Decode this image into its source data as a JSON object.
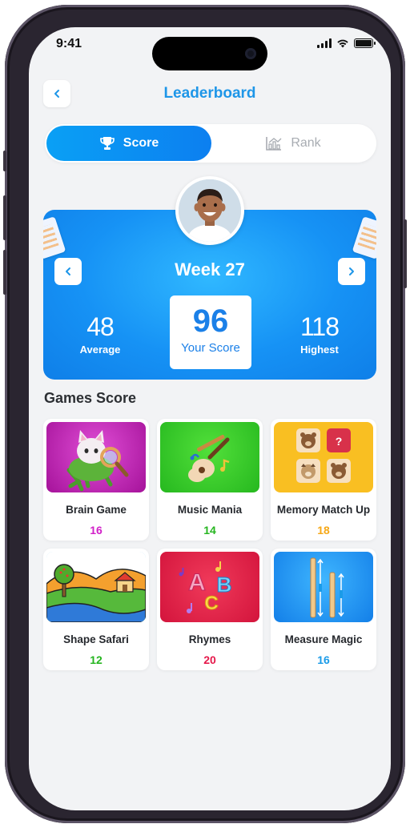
{
  "status_bar": {
    "time": "9:41"
  },
  "header": {
    "title": "Leaderboard"
  },
  "segments": {
    "active_label": "Score",
    "inactive_label": "Rank"
  },
  "score_card": {
    "week_label": "Week 27",
    "average": {
      "value": "48",
      "label": "Average"
    },
    "your_score": {
      "value": "96",
      "label": "Your Score"
    },
    "highest": {
      "value": "118",
      "label": "Highest"
    }
  },
  "games_section": {
    "title": "Games Score",
    "items": [
      {
        "name": "Brain Game",
        "score": "16",
        "score_color": "#d11fc8",
        "thumb": "cat-magnifier-icon"
      },
      {
        "name": "Music Mania",
        "score": "14",
        "score_color": "#25b51f",
        "thumb": "guitar-icon"
      },
      {
        "name": "Memory Match Up",
        "score": "18",
        "score_color": "#f6a817",
        "thumb": "memory-cards-icon"
      },
      {
        "name": "Shape Safari",
        "score": "12",
        "score_color": "#25b51f",
        "thumb": "landscape-icon"
      },
      {
        "name": "Rhymes",
        "score": "20",
        "score_color": "#e5184a",
        "thumb": "abc-letters-icon"
      },
      {
        "name": "Measure Magic",
        "score": "16",
        "score_color": "#1a9be8",
        "thumb": "ruler-icon"
      }
    ]
  },
  "colors": {
    "accent": "#1e96e8",
    "background": "#f2f3f5"
  }
}
